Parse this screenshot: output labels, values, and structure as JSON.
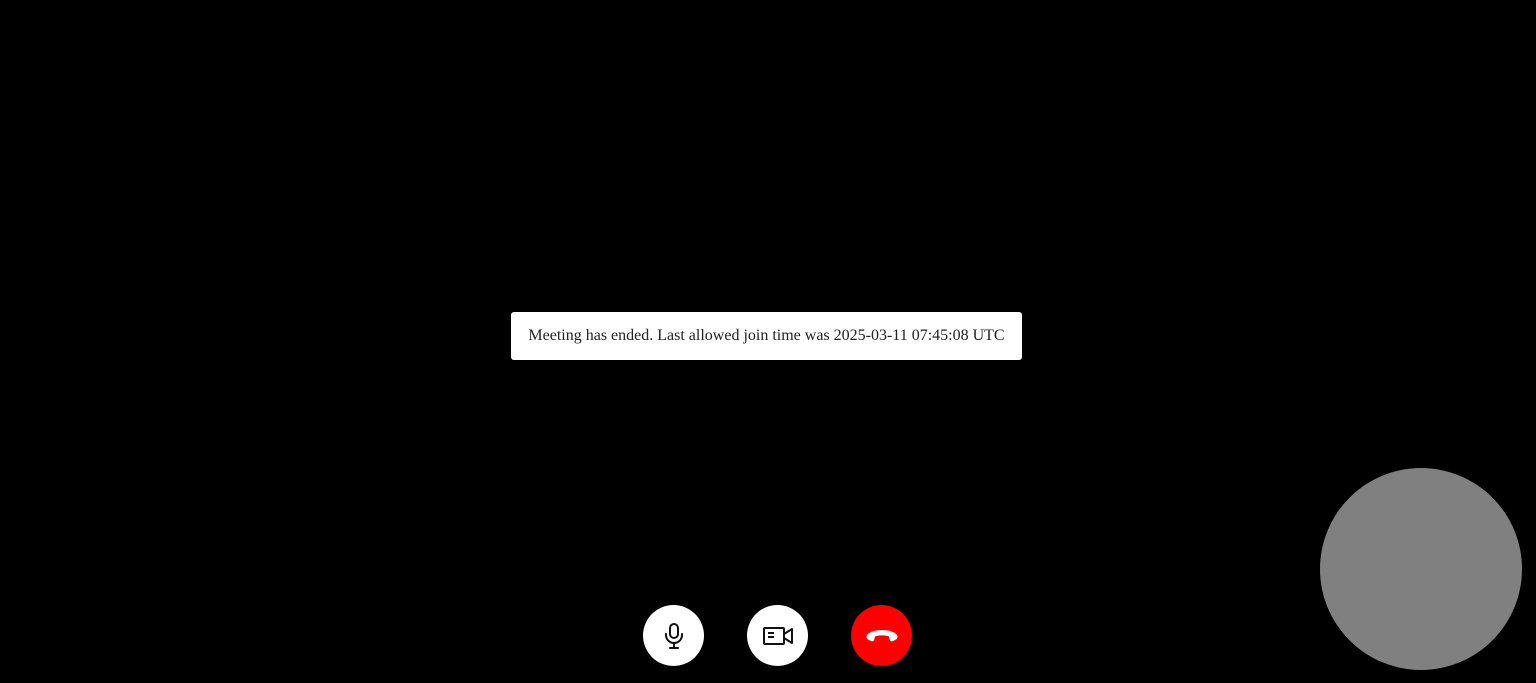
{
  "toast": {
    "message": "Meeting has ended. Last allowed join time was 2025-03-11 07:45:08 UTC"
  },
  "controls": {
    "items": [
      {
        "name": "microphone",
        "icon": "microphone-icon",
        "color": "#ffffff"
      },
      {
        "name": "camera",
        "icon": "video-camera-icon",
        "color": "#ffffff"
      },
      {
        "name": "end-call",
        "icon": "phone-hangup-icon",
        "color": "#ff0000"
      }
    ]
  },
  "colors": {
    "background": "#000000",
    "self_view": "#808080",
    "hangup": "#ff0000"
  }
}
